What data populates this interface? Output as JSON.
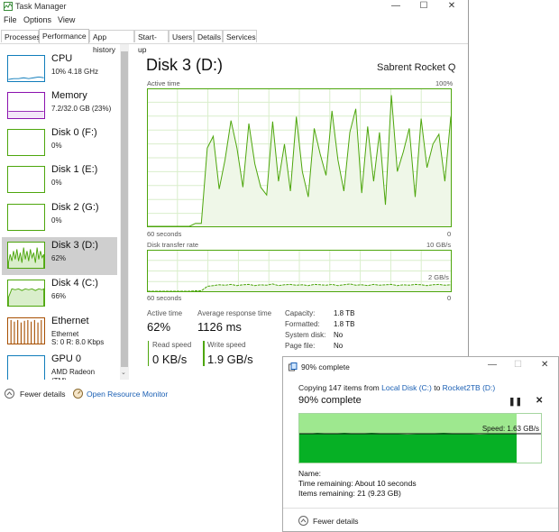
{
  "window": {
    "title": "Task Manager",
    "menu": [
      "File",
      "Options",
      "View"
    ]
  },
  "tabs": [
    "Processes",
    "Performance",
    "App history",
    "Start-up",
    "Users",
    "Details",
    "Services"
  ],
  "active_tab": "Performance",
  "sidebar": {
    "items": [
      {
        "name": "CPU",
        "sub": "10% 4.18 GHz",
        "color": "#117dbb"
      },
      {
        "name": "Memory",
        "sub": "7.2/32.0 GB (23%)",
        "color": "#8b12ae"
      },
      {
        "name": "Disk 0 (F:)",
        "sub": "0%",
        "color": "#4da60c"
      },
      {
        "name": "Disk 1 (E:)",
        "sub": "0%",
        "color": "#4da60c"
      },
      {
        "name": "Disk 2 (G:)",
        "sub": "0%",
        "color": "#4da60c"
      },
      {
        "name": "Disk 3 (D:)",
        "sub": "62%",
        "color": "#4da60c"
      },
      {
        "name": "Disk 4 (C:)",
        "sub": "66%",
        "color": "#4da60c"
      },
      {
        "name": "Ethernet",
        "sub": "Ethernet",
        "sub2": "S: 0 R: 8.0 Kbps",
        "color": "#a74f01"
      },
      {
        "name": "GPU 0",
        "sub": "AMD Radeon (TM)...",
        "color": "#117dbb"
      }
    ]
  },
  "main": {
    "title": "Disk 3 (D:)",
    "device": "Sabrent Rocket Q",
    "active_label": "Active time",
    "active_max": "100%",
    "active_left": "60 seconds",
    "active_right": "0",
    "transfer_label": "Disk transfer rate",
    "transfer_max": "10 GB/s",
    "transfer_mid": "2 GB/s",
    "transfer_left": "60 seconds",
    "transfer_right": "0",
    "stats": {
      "active_time_label": "Active time",
      "active_time": "62%",
      "response_label": "Average response time",
      "response": "1126 ms",
      "read_label": "Read speed",
      "read": "0 KB/s",
      "write_label": "Write speed",
      "write": "1.9 GB/s"
    },
    "info": [
      {
        "key": "Capacity:",
        "val": "1.8 TB"
      },
      {
        "key": "Formatted:",
        "val": "1.8 TB"
      },
      {
        "key": "System disk:",
        "val": "No"
      },
      {
        "key": "Page file:",
        "val": "No"
      }
    ]
  },
  "footer": {
    "fewer": "Fewer details",
    "resmon": "Open Resource Monitor"
  },
  "active_series": [
    0,
    0,
    0,
    0,
    0,
    0,
    0,
    0,
    3,
    3,
    80,
    92,
    38,
    68,
    108,
    80,
    40,
    105,
    64,
    40,
    32,
    107,
    46,
    84,
    36,
    112,
    56,
    30,
    100,
    74,
    52,
    118,
    68,
    36,
    96,
    120,
    34,
    102,
    46,
    96,
    22,
    134,
    56,
    76,
    100,
    30,
    110,
    60,
    84,
    94,
    46,
    112
  ],
  "transfer_series": [
    0,
    0,
    0,
    0,
    0,
    0,
    0,
    0,
    0.1,
    0.1,
    1.2,
    1.4,
    1.6,
    1.5,
    1.7,
    1.4,
    1.6,
    1.7,
    1.4,
    1.6,
    1.5,
    1.8,
    1.4,
    1.6,
    1.7,
    1.5,
    1.6,
    1.4,
    1.7,
    1.6,
    1.5,
    1.7,
    1.4,
    1.6,
    1.8,
    1.5,
    1.6,
    1.4,
    1.7,
    1.5,
    1.6,
    1.7,
    1.4,
    1.6,
    1.5,
    1.7,
    1.6,
    1.4,
    1.6,
    1.7,
    1.5,
    1.6
  ],
  "copy_dialog": {
    "title": "90% complete",
    "line_prefix": "Copying 147 items from ",
    "source": "Local Disk (C:)",
    "to": " to ",
    "dest": "Rocket2TB (D:)",
    "percent_text": "90% complete",
    "progress": 0.9,
    "speed": "Speed: 1.63 GB/s",
    "name_label": "Name:",
    "time_remaining": "Time remaining:  About 10 seconds",
    "items_remaining": "Items remaining:  21 (9.23 GB)",
    "fewer": "Fewer details"
  },
  "colors": {
    "disk_green": "#4da60c",
    "disk_fill": "#eff7e8",
    "link": "#1a5fb4"
  }
}
